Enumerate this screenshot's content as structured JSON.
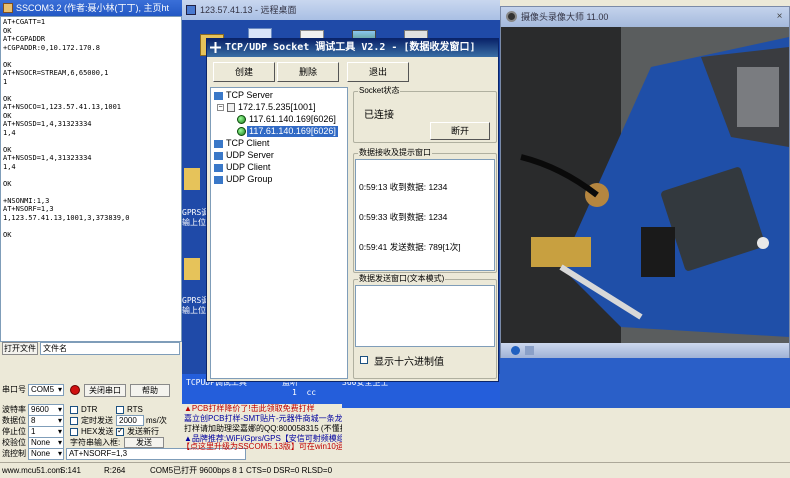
{
  "sscom": {
    "title": "SSCOM3.2 (作者:聂小林(丁丁), 主页ht",
    "receive_lines": [
      "AT+CGATT=1",
      "OK",
      "AT+CGPADDR",
      "+CGPADDR:0,10.172.170.8",
      "",
      "OK",
      "AT+NSOCR=STREAM,6,65000,1",
      "1",
      "",
      "OK",
      "AT+NSOCO=1,123.57.41.13,1001",
      "OK",
      "AT+NSOSD=1,4,31323334",
      "1,4",
      "",
      "OK",
      "AT+NSOSD=1,4,31323334",
      "1,4",
      "",
      "OK",
      "",
      "+NSONMI:1,3",
      "AT+NSORF=1,3",
      "1,123.57.41.13,1001,3,373839,0",
      "",
      "OK"
    ],
    "open_file_button": "打开文件",
    "file_name_label": "文件名",
    "port_label": "串口号",
    "port_value": "COM5",
    "close_port_button": "关闭串口",
    "help_button": "帮助",
    "baud_label": "波特率",
    "baud_value": "9600",
    "data_bits_label": "数据位",
    "data_bits_value": "8",
    "stop_bits_label": "停止位",
    "stop_bits_value": "1",
    "parity_label": "校验位",
    "parity_value": "None",
    "flow_label": "流控制",
    "flow_value": "None",
    "dtr_label": "DTR",
    "rts_label": "RTS",
    "timed_send_label": "定时发送",
    "interval_value": "2000",
    "interval_unit": "ms/次",
    "hex_send_label": "HEX发送",
    "newline_label": "发送新行",
    "input_label": "字符串输入框:",
    "send_button": "发送",
    "send_text": "AT+NSORF=1,3"
  },
  "ad": {
    "lines": [
      "▲PCB打样降价了!击此领取免费打样",
      "嘉立创PCB打样-SMT贴片-元器件商城一条龙服务",
      "打样请加助理梁嘉娜的QQ:800058315 (不懂技术)",
      "▲品牌推荐:WiFi/Gprs/GPS【安信可射频模组】",
      "【点这里升级为SSCOM5.13版】可在win10运行!"
    ]
  },
  "remote": {
    "title": "123.57.41.13 - 远程桌面",
    "desktop_labels": [
      "GPRS调\n输上位",
      "GPRS调\n输上位"
    ],
    "taskbar_labels": [
      "TCPUDP调试工具",
      "蓝听",
      "360安全卫士"
    ],
    "taskbar_extra": "1  cc"
  },
  "tcp": {
    "title": "TCP/UDP Socket 调试工具 V2.2 - [数据收发窗口]",
    "buttons": [
      "创建",
      "删除",
      "退出"
    ],
    "tree": {
      "tcp_server": "TCP Server",
      "server_node": "172.17.5.235[1001]",
      "clients": [
        "117.61.140.169[6026]",
        "117.61.140.169[6026]"
      ],
      "tcp_client": "TCP Client",
      "udp_server": "UDP Server",
      "udp_client": "UDP Client",
      "udp_group": "UDP Group"
    },
    "socket_state_label": "Socket状态",
    "socket_state": "已连接",
    "disconnect_button": "断开",
    "recv_label": "数据接收及提示窗口",
    "recv_lines": [
      "0:59:13 收到数据: 1234",
      "0:59:33 收到数据: 1234",
      "0:59:41 发送数据: 789[1次]"
    ],
    "send_label": "数据发送窗口(文本模式)",
    "hex_label": "显示十六进制值"
  },
  "camera": {
    "title": "摄像头录像大师 11.00",
    "close": "×"
  },
  "status": {
    "site": "www.mcu51.com",
    "s": "S:141",
    "r": "R:264",
    "port_state": "COM5已打开  9600bps  8  1",
    "lines": "CTS=0 DSR=0 RLSD=0"
  },
  "colors": {
    "title_blue": "#2358c4",
    "desktop_blue": "#1f4aa8",
    "selection": "#316ac5"
  }
}
